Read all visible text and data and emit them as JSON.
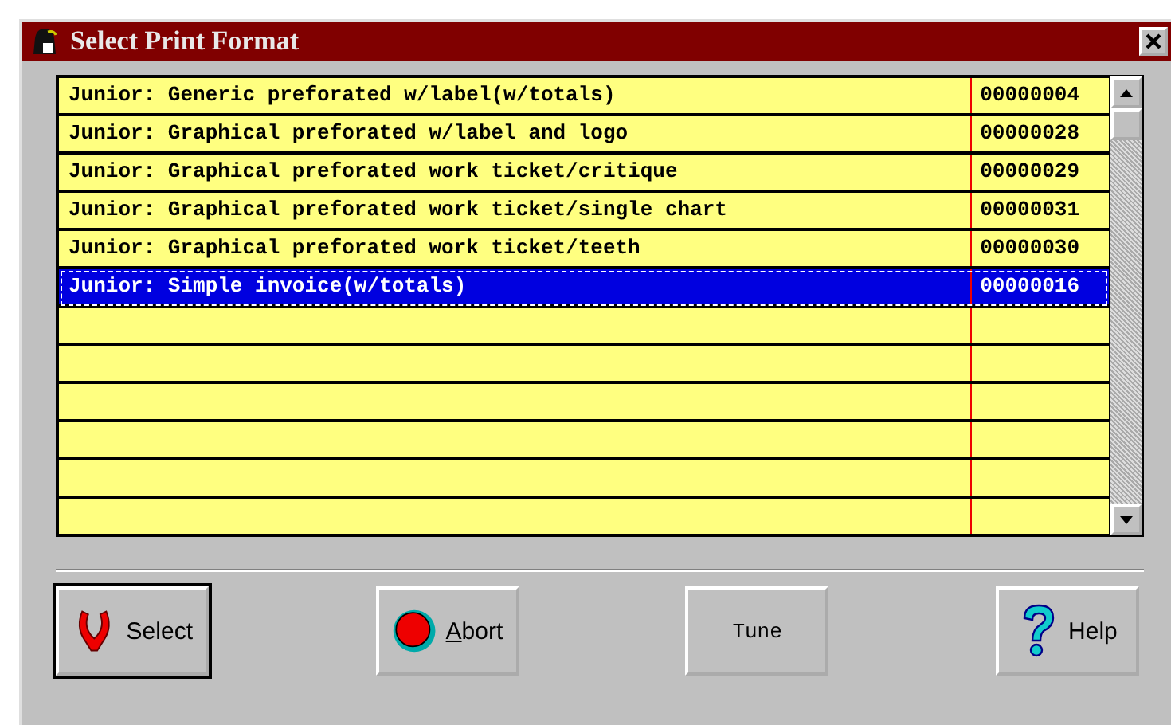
{
  "window": {
    "title": "Select Print Format"
  },
  "formats": [
    {
      "name": "Junior: Generic preforated w/label(w/totals)",
      "code": "00000004",
      "selected": false
    },
    {
      "name": "Junior: Graphical preforated w/label and logo",
      "code": "00000028",
      "selected": false
    },
    {
      "name": "Junior: Graphical preforated work ticket/critique",
      "code": "00000029",
      "selected": false
    },
    {
      "name": "Junior: Graphical preforated work ticket/single chart",
      "code": "00000031",
      "selected": false
    },
    {
      "name": "Junior: Graphical preforated work ticket/teeth",
      "code": "00000030",
      "selected": false
    },
    {
      "name": "Junior: Simple invoice(w/totals)",
      "code": "00000016",
      "selected": true
    }
  ],
  "buttons": [
    {
      "label": "Select",
      "kind": "select"
    },
    {
      "label": "Abort",
      "kind": "abort"
    },
    {
      "label": "Tune",
      "kind": "plain"
    },
    {
      "label": "Help",
      "kind": "help"
    }
  ]
}
